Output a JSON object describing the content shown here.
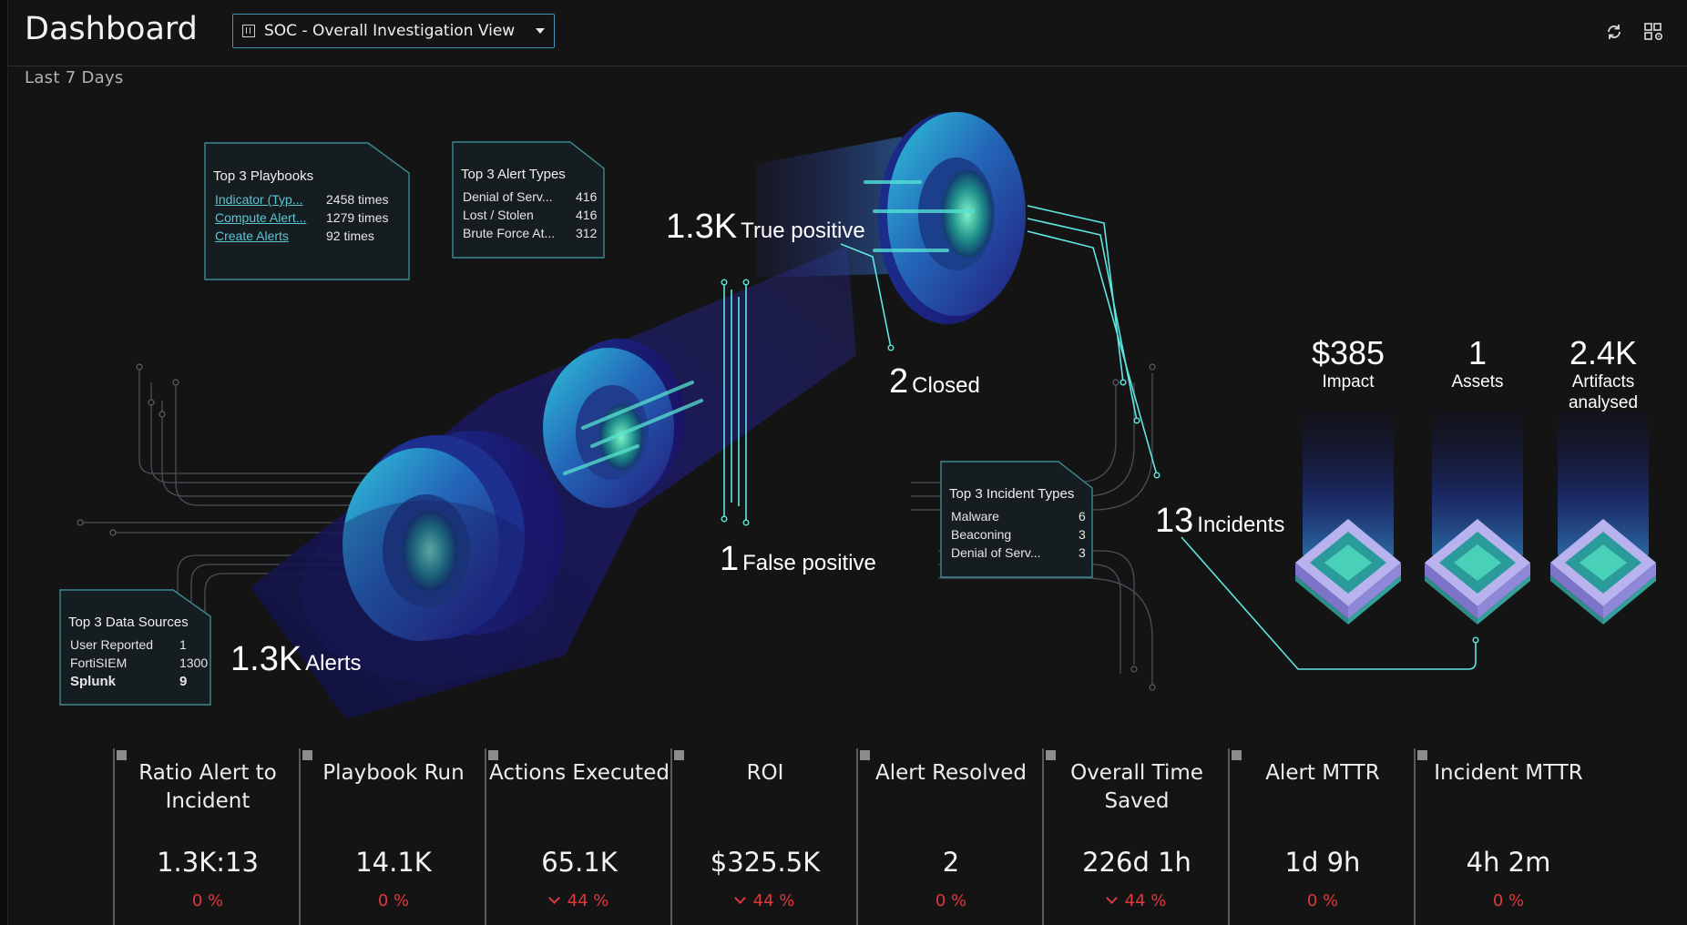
{
  "header": {
    "title": "Dashboard",
    "dashboard_select": "SOC - Overall Investigation View",
    "date_range": "Last 7 Days"
  },
  "icons": [
    "refresh-icon",
    "layout-settings-icon",
    "dashboard-view-icon",
    "chevron-down-icon"
  ],
  "colors": {
    "background": "#141414",
    "accent": "#3f97b5",
    "line": "#5fe6e0",
    "link": "#5cc5d4",
    "delta_negative": "#e0373d"
  },
  "funnel": {
    "alerts": {
      "value": "1.3K",
      "label": "Alerts"
    },
    "true_positive": {
      "value": "1.3K",
      "label": "True positive"
    },
    "false_positive": {
      "value": "1",
      "label": "False positive"
    },
    "closed": {
      "value": "2",
      "label": "Closed"
    },
    "incidents": {
      "value": "13",
      "label": "Incidents"
    }
  },
  "cards": {
    "playbooks": {
      "title": "Top 3 Playbooks",
      "rows": [
        {
          "name": "Indicator (Typ...",
          "value": "2458 times"
        },
        {
          "name": "Compute Alert...",
          "value": "1279 times"
        },
        {
          "name": "Create Alerts",
          "value": "92 times"
        }
      ]
    },
    "alert_types": {
      "title": "Top 3 Alert Types",
      "rows": [
        {
          "name": "Denial of Serv...",
          "value": "416"
        },
        {
          "name": "Lost / Stolen",
          "value": "416"
        },
        {
          "name": "Brute Force At...",
          "value": "312"
        }
      ]
    },
    "incident_types": {
      "title": "Top 3 Incident Types",
      "rows": [
        {
          "name": "Malware",
          "value": "6"
        },
        {
          "name": "Beaconing",
          "value": "3"
        },
        {
          "name": "Denial of Serv...",
          "value": "3"
        }
      ]
    },
    "data_sources": {
      "title": "Top 3 Data Sources",
      "rows": [
        {
          "name": "User Reported",
          "value": "1"
        },
        {
          "name": "FortiSIEM",
          "value": "1300"
        },
        {
          "name": "Splunk",
          "value": "9"
        }
      ]
    }
  },
  "stats": {
    "impact": {
      "value": "$385",
      "label": "Impact"
    },
    "assets": {
      "value": "1",
      "label": "Assets"
    },
    "artifacts": {
      "value": "2.4K",
      "label": "Artifacts analysed"
    }
  },
  "metrics": [
    {
      "title": "Ratio Alert to Incident",
      "value": "1.3K:13",
      "delta": "0 %",
      "trend": "none"
    },
    {
      "title": "Playbook Run",
      "value": "14.1K",
      "delta": "0 %",
      "trend": "none"
    },
    {
      "title": "Actions Executed",
      "value": "65.1K",
      "delta": "44 %",
      "trend": "down"
    },
    {
      "title": "ROI",
      "value": "$325.5K",
      "delta": "44 %",
      "trend": "down"
    },
    {
      "title": "Alert Resolved",
      "value": "2",
      "delta": "0 %",
      "trend": "none"
    },
    {
      "title": "Overall Time Saved",
      "value": "226d 1h",
      "delta": "44 %",
      "trend": "down"
    },
    {
      "title": "Alert MTTR",
      "value": "1d 9h",
      "delta": "0 %",
      "trend": "none"
    },
    {
      "title": "Incident MTTR",
      "value": "4h 2m",
      "delta": "0 %",
      "trend": "none"
    }
  ]
}
